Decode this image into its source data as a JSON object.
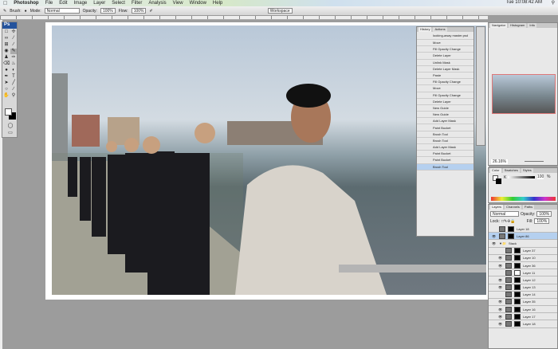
{
  "menubar": {
    "app": "Photoshop",
    "items": [
      "File",
      "Edit",
      "Image",
      "Layer",
      "Select",
      "Filter",
      "Analysis",
      "View",
      "Window",
      "Help"
    ],
    "clock": "Tue 10:08:42 AM"
  },
  "options": {
    "brush_label": "Brush:",
    "mode_label": "Mode:",
    "mode": "Normal",
    "opacity_label": "Opacity:",
    "opacity": "100%",
    "flow_label": "Flow:",
    "flow": "100%",
    "workspace": "Workspace"
  },
  "toolbox": {
    "logo": "Ps"
  },
  "history": {
    "tabs": [
      "History",
      "Actions"
    ],
    "snapshot": "looking-away master.psd",
    "items": [
      "Move",
      "Fill Opacity Change",
      "Delete Layer",
      "Unlink Mask",
      "Delete Layer Mask",
      "Paste",
      "Fill Opacity Change",
      "Move",
      "Fill Opacity Change",
      "Delete Layer",
      "New Guide",
      "New Guide",
      "Add Layer Mask",
      "Paint Bucket",
      "Brush Tool",
      "Brush Tool",
      "Add Layer Mask",
      "Paint Bucket",
      "Paint Bucket",
      "Brush Tool"
    ],
    "current": 19
  },
  "navigator": {
    "tabs": [
      "Navigator",
      "Histogram",
      "Info"
    ],
    "zoom": "26.16%"
  },
  "color": {
    "tabs": [
      "Color",
      "Swatches",
      "Styles"
    ],
    "channel": "K",
    "value": "100",
    "unit": "%"
  },
  "layers": {
    "tabs": [
      "Layers",
      "Channels",
      "Paths"
    ],
    "mode": "Normal",
    "opacity_label": "Opacity:",
    "opacity": "100%",
    "lock_label": "Lock:",
    "fill_label": "Fill:",
    "fill": "100%",
    "group": "Stack",
    "items": [
      {
        "name": "Layer 18",
        "visible": false,
        "mask": "black"
      },
      {
        "name": "Layer 86",
        "visible": true,
        "mask": "black",
        "selected": true
      }
    ],
    "group_items": [
      {
        "name": "Layer 37",
        "visible": false
      },
      {
        "name": "Layer 10",
        "visible": true
      },
      {
        "name": "Layer 36",
        "visible": true
      },
      {
        "name": "Layer 11",
        "visible": false,
        "mask": "white"
      },
      {
        "name": "Layer 12",
        "visible": true
      },
      {
        "name": "Layer 13",
        "visible": true
      },
      {
        "name": "Layer 14",
        "visible": false
      },
      {
        "name": "Layer 35",
        "visible": true
      },
      {
        "name": "Layer 16",
        "visible": true
      },
      {
        "name": "Layer 17",
        "visible": true
      },
      {
        "name": "Layer 18",
        "visible": true
      }
    ]
  }
}
